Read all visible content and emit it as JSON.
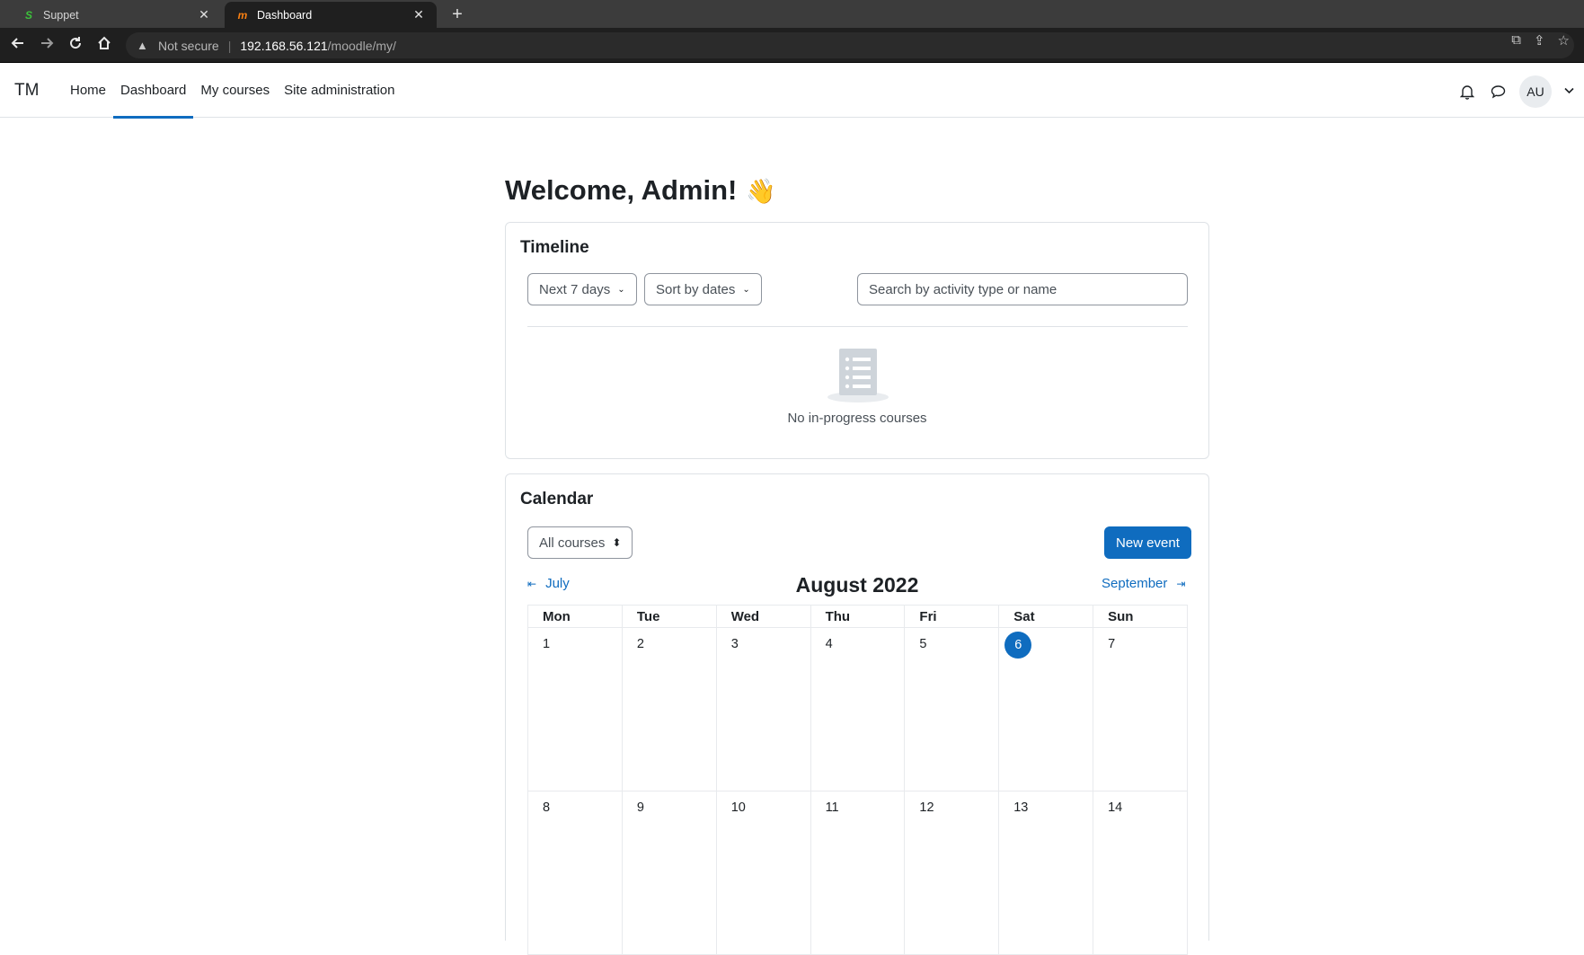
{
  "browser": {
    "tabs": [
      {
        "title": "Suppet",
        "favicon": "S",
        "active": false
      },
      {
        "title": "Dashboard",
        "favicon": "m",
        "active": true
      }
    ],
    "address": {
      "security_label": "Not secure",
      "host": "192.168.56.121",
      "path": "/moodle/my/"
    }
  },
  "navbar": {
    "brand": "TM",
    "items": [
      {
        "label": "Home"
      },
      {
        "label": "Dashboard"
      },
      {
        "label": "My courses"
      },
      {
        "label": "Site administration"
      }
    ],
    "avatar_initials": "AU"
  },
  "page": {
    "title": "Welcome, Admin!",
    "title_emoji": "👋"
  },
  "timeline": {
    "title": "Timeline",
    "filter_label": "Next 7 days",
    "sort_label": "Sort by dates",
    "search_placeholder": "Search by activity type or name",
    "empty_text": "No in-progress courses"
  },
  "calendar": {
    "title": "Calendar",
    "course_filter": "All courses",
    "new_event_label": "New event",
    "prev_month": "July",
    "next_month": "September",
    "month_title": "August 2022",
    "weekdays": [
      "Mon",
      "Tue",
      "Wed",
      "Thu",
      "Fri",
      "Sat",
      "Sun"
    ],
    "weeks": [
      [
        "1",
        "2",
        "3",
        "4",
        "5",
        "6",
        "7"
      ],
      [
        "8",
        "9",
        "10",
        "11",
        "12",
        "13",
        "14"
      ]
    ],
    "today": "6"
  },
  "colors": {
    "primary": "#0f6cbf",
    "text": "#1d2125",
    "border": "#dee2e6"
  }
}
